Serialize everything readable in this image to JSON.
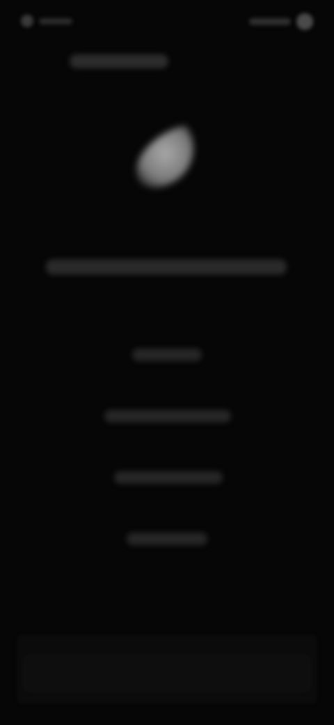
{
  "screen": {
    "background": "#060606",
    "content_state": "blurred-unreadable"
  },
  "status_bar": {
    "indicators": [
      "signal-icon",
      "battery-icon"
    ]
  },
  "emblem": {
    "icon": "leaf-icon",
    "color": "#9a9a9a"
  }
}
